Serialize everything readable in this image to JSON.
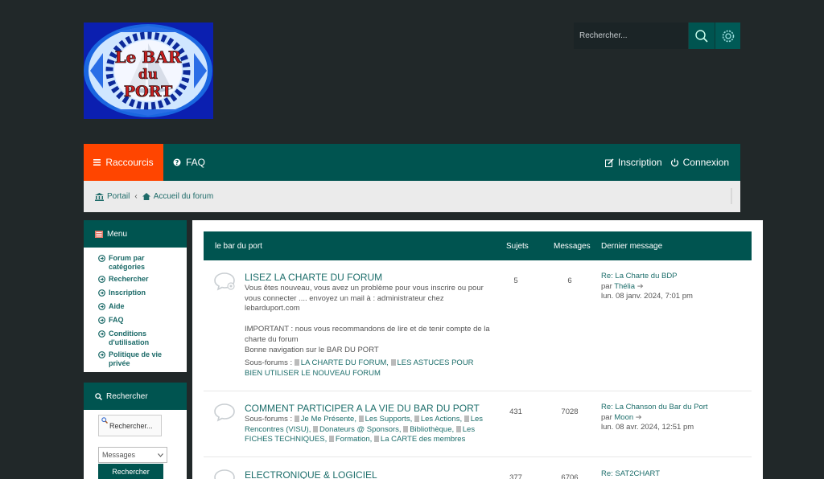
{
  "logo": {
    "line1": "Le BAR",
    "line2": "du",
    "line3": "PORT"
  },
  "search": {
    "placeholder": "Rechercher..."
  },
  "nav": {
    "shortcuts": "Raccourcis",
    "faq": "FAQ",
    "register": "Inscription",
    "login": "Connexion"
  },
  "breadcrumb": {
    "portal": "Portail",
    "index": "Accueil du forum"
  },
  "sidebar": {
    "menu_title": "Menu",
    "menu_items": [
      {
        "label": "Forum par catégories"
      },
      {
        "label": "Rechercher"
      },
      {
        "label": "Inscription"
      },
      {
        "label": "Aide"
      },
      {
        "label": "FAQ"
      },
      {
        "label": "Conditions d'utilisation"
      },
      {
        "label": "Politique de vie privée"
      }
    ],
    "search_title": "Rechercher",
    "search_input": "Rechercher...",
    "search_select": "Messages",
    "search_button": "Rechercher"
  },
  "category": {
    "title": "le bar du port",
    "col_topics": "Sujets",
    "col_posts": "Messages",
    "col_last": "Dernier message"
  },
  "forums": [
    {
      "title": "LISEZ LA CHARTE DU FORUM",
      "desc1": "Vous êtes nouveau, vous avez un problème pour vous inscrire ou pour vous connecter .... envoyez un mail à : administrateur chez lebarduport.com",
      "desc2": "IMPORTANT : nous vous recommandons de lire et de tenir compte de la charte du forum",
      "desc3": "Bonne navigation sur le BAR DU PORT",
      "subforums_label": "Sous-forums :",
      "subforums": [
        "LA CHARTE DU FORUM,",
        "LES ASTUCES POUR BIEN UTILISER LE NOUVEAU FORUM"
      ],
      "topics": "5",
      "posts": "6",
      "last_title": "Re: La Charte du BDP",
      "last_by": "par",
      "last_author": "Thélia",
      "last_date": "lun. 08 janv. 2024, 7:01 pm"
    },
    {
      "title": "COMMENT PARTICIPER A LA VIE DU BAR DU PORT",
      "subforums_label": "Sous-forums :",
      "subforums": [
        "Je Me Présente,",
        "Les Supports,",
        "Les Actions,",
        "Les Rencontres (VISU),",
        "Donateurs @ Sponsors,",
        "Bibliothèque,",
        "Les FICHES TECHNIQUES,",
        "Formation,",
        "La CARTE des membres"
      ],
      "topics": "431",
      "posts": "7028",
      "last_title": "Re: La Chanson du Bar du Port",
      "last_by": "par",
      "last_author": "Moon",
      "last_date": "lun. 08 avr. 2024, 12:51 pm"
    },
    {
      "title": "ELECTRONIQUE & LOGICIEL",
      "topics": "377",
      "posts": "6706",
      "last_title": "Re: SAT2CHART"
    }
  ]
}
